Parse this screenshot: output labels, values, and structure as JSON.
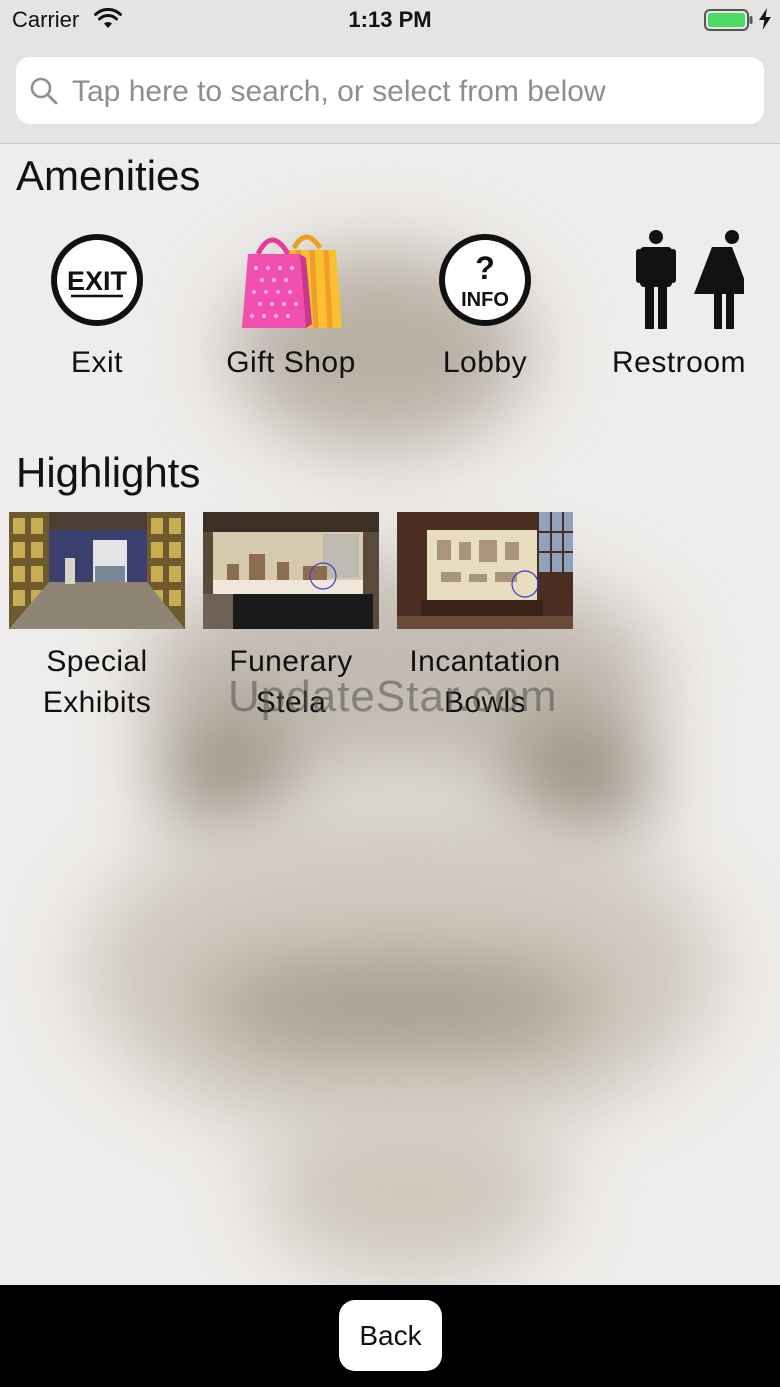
{
  "status_bar": {
    "carrier": "Carrier",
    "time": "1:13 PM",
    "battery_color": "#4cd964"
  },
  "search": {
    "placeholder": "Tap here to search, or select from below"
  },
  "amenities": {
    "title": "Amenities",
    "items": [
      {
        "label": "Exit",
        "icon": "exit-sign-icon"
      },
      {
        "label": "Gift Shop",
        "icon": "shopping-bags-icon"
      },
      {
        "label": "Lobby",
        "icon": "info-icon",
        "icon_text_top": "?",
        "icon_text_bottom": "INFO"
      },
      {
        "label": "Restroom",
        "icon": "restroom-icon"
      }
    ],
    "exit_icon_text": "EXIT"
  },
  "highlights": {
    "title": "Highlights",
    "items": [
      {
        "label_line1": "Special",
        "label_line2": "Exhibits"
      },
      {
        "label_line1": "Funerary",
        "label_line2": "Stela"
      },
      {
        "label_line1": "Incantation",
        "label_line2": "Bowls"
      }
    ]
  },
  "watermark": "UpdateStar.com",
  "footer": {
    "back_label": "Back"
  }
}
